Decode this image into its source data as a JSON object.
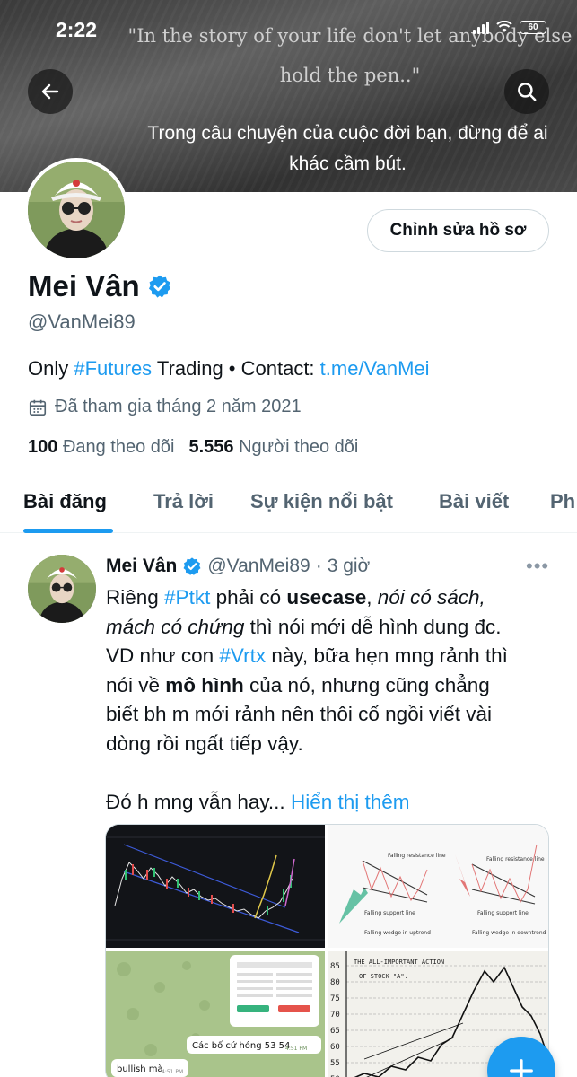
{
  "status_bar": {
    "time": "2:22",
    "battery": "60"
  },
  "banner": {
    "quote_en": "\"In the story of your life don't let anybody else hold the pen..\"",
    "quote_vi": "Trong câu chuyện của cuộc đời bạn, đừng để ai khác cầm bút."
  },
  "icons": {
    "back": "arrow-left-icon",
    "search": "search-icon",
    "verified": "verified-badge-icon",
    "calendar": "calendar-icon",
    "more": "more-icon",
    "compose": "plus-icon"
  },
  "colors": {
    "accent": "#1d9bf0",
    "text": "#0f1419",
    "muted": "#536471"
  },
  "profile": {
    "edit_button": "Chỉnh sửa hồ sơ",
    "name": "Mei Vân",
    "handle": "@VanMei89",
    "bio_prefix": "Only ",
    "bio_hashtag": "#Futures",
    "bio_middle": " Trading • Contact: ",
    "bio_link": "t.me/VanMei",
    "joined": "Đã tham gia tháng 2 năm 2021",
    "following_count": "100",
    "following_label": "Đang theo dõi",
    "followers_count": "5.556",
    "followers_label": "Người theo dõi"
  },
  "tabs": [
    {
      "label": "Bài đăng",
      "active": true
    },
    {
      "label": "Trả lời",
      "active": false
    },
    {
      "label": "Sự kiện nổi bật",
      "active": false
    },
    {
      "label": "Bài viết",
      "active": false
    },
    {
      "label": "Ph",
      "active": false
    }
  ],
  "post": {
    "name": "Mei Vân",
    "handle": "@VanMei89",
    "separator": "·",
    "time": "3 giờ",
    "line1": {
      "a": "Riêng ",
      "tag": "#Ptkt",
      "b": " phải có ",
      "bold": "usecase",
      "c": ", ",
      "italic": "nói có sách,"
    },
    "line2": {
      "italic": "mách có chứng",
      "rest": " thì nói mới dễ hình dung đc."
    },
    "line3": {
      "a": "VD như con ",
      "tag": "#Vrtx",
      "b": " này, bữa hẹn mng rảnh thì"
    },
    "line4": {
      "a": "nói về ",
      "bold": "mô hình",
      "b": " của nó, nhưng cũng chẳng"
    },
    "line5": "biết bh m mới rảnh nên thôi cố ngồi viết vài",
    "line6": "dòng rồi ngất tiếp vậy.",
    "line7": {
      "a": "Đó h mng vẫn hay... ",
      "more": "Hiển thị thêm"
    }
  },
  "media": {
    "chart_label_1": "Falling resistance line",
    "chart_label_2": "Falling support line",
    "chart_label_3": "Falling wedge in uptrend",
    "chart_label_4": "Falling resistance line",
    "chart_label_5": "Falling support line",
    "chart_label_6": "Falling wedge in downtrend",
    "chat_1": "Các bố cứ hóng 53 54",
    "chat_1_time": "4:51 PM",
    "chat_2": "bullish mà",
    "chat_2_time": "4:51 PM",
    "sketch_title": "THE ALL-IMPORTANT ACTION",
    "sketch_sub": "OF STOCK \"A\".",
    "sketch_y": [
      "85",
      "80",
      "75",
      "70",
      "65",
      "60",
      "55",
      "50"
    ]
  }
}
